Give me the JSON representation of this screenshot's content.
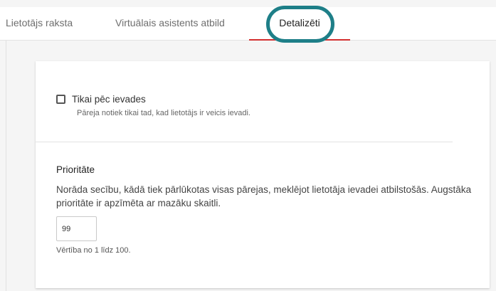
{
  "tabs": [
    {
      "label": "Lietotājs raksta",
      "active": false
    },
    {
      "label": "Virtuālais asistents atbild",
      "active": false
    },
    {
      "label": "Detalizēti",
      "active": true
    }
  ],
  "colors": {
    "active_tab_underline": "#d32f2f",
    "highlight_ring": "#1e7f88"
  },
  "options": {
    "only_after_input": {
      "label": "Tikai pēc ievades",
      "checked": false,
      "help": "Pāreja notiek tikai tad, kad lietotājs ir veicis ievadi."
    }
  },
  "priority": {
    "title": "Prioritāte",
    "description": "Norāda secību, kādā tiek pārlūkotas visas pārejas, meklējot lietotāja ievadei atbilstošās. Augstāka prioritāte ir apzīmēta ar mazāku skaitli.",
    "value": "99",
    "help": "Vērtība no 1 līdz 100."
  }
}
